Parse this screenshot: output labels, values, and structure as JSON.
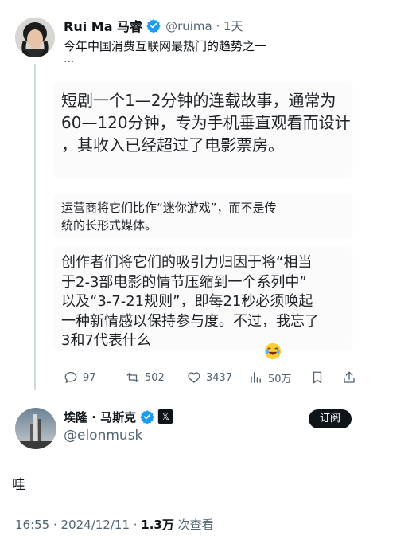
{
  "post": {
    "author_name": "Rui Ma 马睿",
    "handle_time": "@ruima · 1天",
    "snippet": "今年中国消费互联网最热门的趋势之一",
    "ellipsis": "...",
    "quote_para1": [
      "短剧一个1—2分钟的连载故事，通常为",
      "60—120分钟，专为手机垂直观看而设计",
      "，其收入已经超过了电影票房。"
    ],
    "quote_para2": [
      "运营商将它们比作“迷你游戏”，而不是传",
      "统的长形式媒体。"
    ],
    "quote_para3": [
      "创作者们将它们的吸引力归因于将“相当",
      "于2-3部电影的情节压缩到一个系列中”",
      "以及“3-7-21规则”，即每21秒必须唤起",
      "一种新情感以保持参与度。不过，我忘了",
      "3和7代表什么"
    ],
    "emoji": "laughing-emoji",
    "stats": {
      "replies": "97",
      "reposts": "502",
      "likes": "3437",
      "views": "50万"
    }
  },
  "reply": {
    "author_name": "埃隆 · 马斯克",
    "affiliation_badge": "𝕏",
    "handle": "@elonmusk",
    "subscribe_label": "订阅",
    "text": "哇",
    "time": "16:55 · 2024/12/11 · ",
    "views_count": "1.3万",
    "views_label": " 次查看"
  },
  "colors": {
    "verified_blue": "#1d9bf0",
    "secondary_text": "#536471",
    "thread_line": "#cfd9de"
  }
}
